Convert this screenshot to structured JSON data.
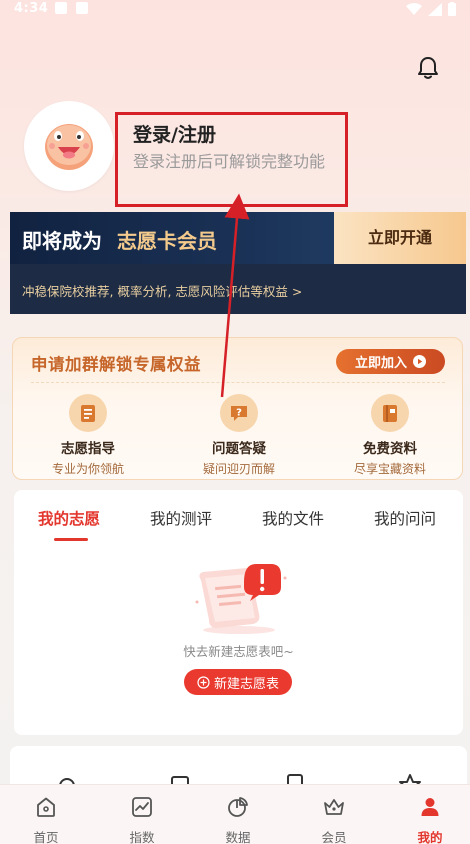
{
  "status": {
    "time": "4:34"
  },
  "profile": {
    "login_title": "登录/注册",
    "login_subtitle": "登录注册后可解锁完整功能"
  },
  "vip": {
    "title_prefix": "即将成为",
    "title_highlight": "志愿卡会员",
    "cta": "立即开通",
    "benefits": "冲稳保院校推荐, 概率分析, 志愿风险评估等权益 >"
  },
  "group": {
    "title": "申请加群解锁专属权益",
    "join_label": "立即加入",
    "features": [
      {
        "title": "志愿指导",
        "subtitle": "专业为你领航",
        "icon": "document-list-icon"
      },
      {
        "title": "问题答疑",
        "subtitle": "疑问迎刃而解",
        "icon": "question-chat-icon"
      },
      {
        "title": "免费资料",
        "subtitle": "尽享宝藏资料",
        "icon": "book-icon"
      }
    ]
  },
  "tabs": {
    "items": [
      "我的志愿",
      "我的测评",
      "我的文件",
      "我的问问"
    ],
    "active_index": 0,
    "empty_text": "快去新建志愿表吧~",
    "new_button": "新建志愿表"
  },
  "tabbar": {
    "items": [
      {
        "label": "首页",
        "icon": "home-icon"
      },
      {
        "label": "指数",
        "icon": "trend-chart-icon"
      },
      {
        "label": "数据",
        "icon": "pie-chart-icon"
      },
      {
        "label": "会员",
        "icon": "crown-icon"
      },
      {
        "label": "我的",
        "icon": "person-icon"
      }
    ],
    "active_index": 4
  },
  "colors": {
    "accent": "#e3372e",
    "vip_gold": "#f4cb8c",
    "annotation_red": "#d62027"
  }
}
